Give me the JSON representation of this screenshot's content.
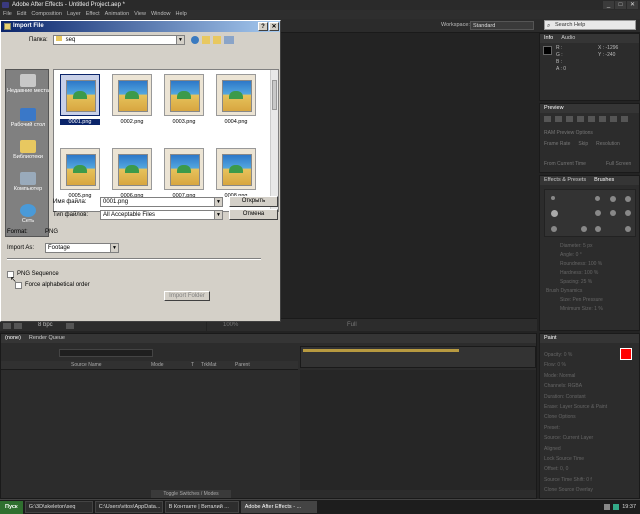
{
  "app": {
    "title": "Adobe After Effects - Untitled Project.aep *",
    "window_buttons": [
      "_",
      "□",
      "✕"
    ]
  },
  "menu": [
    "File",
    "Edit",
    "Composition",
    "Layer",
    "Effect",
    "Animation",
    "View",
    "Window",
    "Help"
  ],
  "toolbar": {
    "workspace_label": "Workspace:",
    "workspace_value": "Standard",
    "search_placeholder": "Search Help"
  },
  "info_panel": {
    "tabs": [
      "Info",
      "Audio"
    ],
    "readouts": [
      "R :",
      "G :",
      "B :",
      "A : 0"
    ],
    "coords": [
      "X : -1296",
      "Y : -240"
    ]
  },
  "preview_panel": {
    "tab": "Preview",
    "ram_options": "RAM Preview Options",
    "rows": [
      "Frame Rate",
      "Skip",
      "Resolution"
    ],
    "from_current": "From Current Time",
    "full_screen": "Full Screen"
  },
  "effects_panel": {
    "tabs": [
      "Effects & Presets",
      "Brushes"
    ],
    "props": [
      "Diameter: 5 px",
      "Angle: 0 °",
      "Roundness: 100 %",
      "Hardness: 100 %",
      "Spacing: 25 %",
      "Brush Dynamics",
      "Size: Pen Pressure",
      "Minimum Size: 1 %"
    ]
  },
  "comp_bar": {
    "zoom": "100%",
    "res": "Full"
  },
  "project_bar": {
    "bpc": "8 bpc"
  },
  "timeline": {
    "tabs": [
      "(none)",
      "Render Queue"
    ],
    "columns": [
      "Source Name",
      "Mode",
      "T",
      "TrkMat",
      "Parent"
    ],
    "toggle_label": "Toggle Switches / Modes"
  },
  "paint_panel": {
    "tab": "Paint",
    "props": [
      "Opacity: 0 %",
      "Flow: 0 %",
      "Mode: Normal",
      "Channels: RGBA",
      "Duration: Constant",
      "Erase: Layer Source & Paint",
      "Clone Options",
      "Preset:",
      "Source: Current Layer",
      "Aligned",
      "Lock Source Time",
      "Offset: 0, 0",
      "Source Time Shift: 0 f",
      "Clone Source Overlay"
    ]
  },
  "taskbar": {
    "start": "Пуск",
    "tasks": [
      "G:\\3D\\skeleton\\seq",
      "C:\\Users\\vitos\\AppData...",
      "В Контакте | Виталий ...",
      "Adobe After Effects - ..."
    ],
    "clock": "19:37"
  },
  "dialog": {
    "title": "Import File",
    "look_in_label": "Папка:",
    "look_in_value": "seq",
    "places": [
      "Недавние места",
      "Рабочий стол",
      "Библиотеки",
      "Компьютер",
      "Сеть"
    ],
    "files": [
      "0001.png",
      "0002.png",
      "0003.png",
      "0004.png",
      "0005.png",
      "0006.png",
      "0007.png",
      "0008.png"
    ],
    "filename_label": "Имя файла:",
    "filename_value": "0001.png",
    "filetype_label": "Тип файлов:",
    "filetype_value": "All Acceptable Files",
    "open_button": "Открыть",
    "cancel_button": "Отмена",
    "format_label": "Format:",
    "format_value": "PNG",
    "import_as_label": "Import As:",
    "import_as_value": "Footage",
    "png_sequence": "PNG Sequence",
    "png_sequence_checked": false,
    "force_alpha": "Force alphabetical order",
    "import_folder": "Import Folder"
  }
}
